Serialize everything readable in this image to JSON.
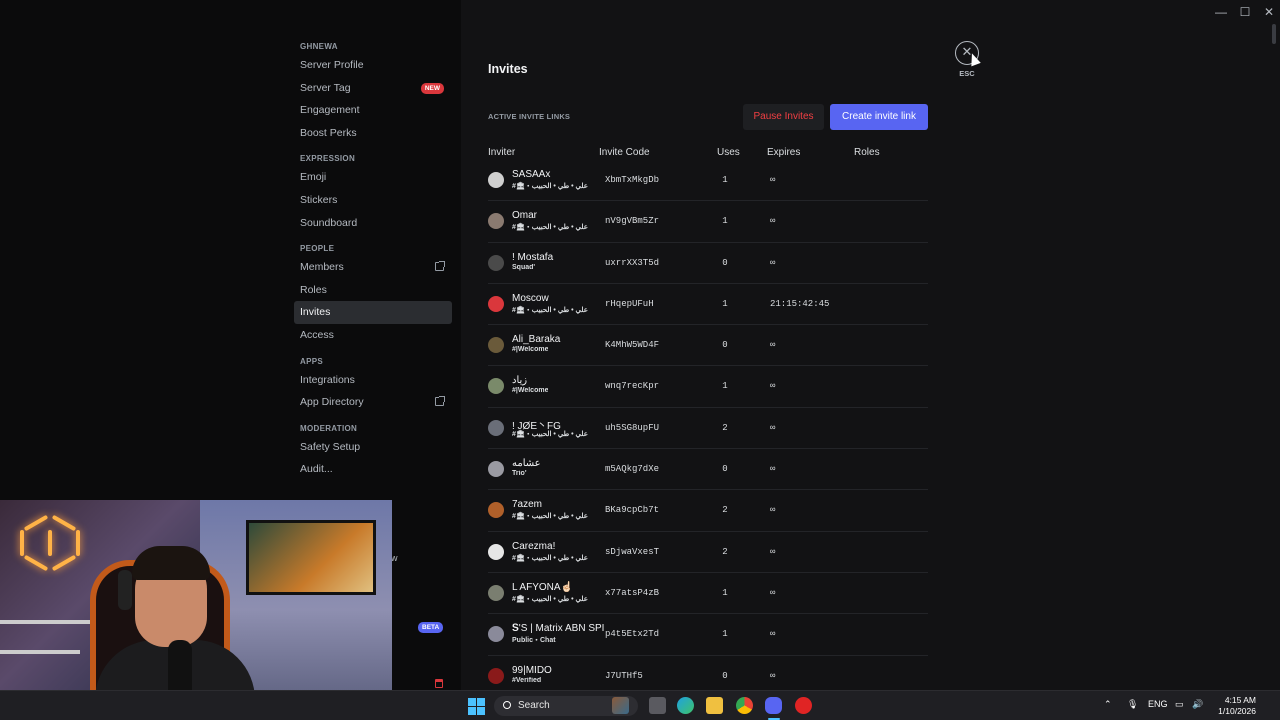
{
  "window": {
    "minimize": "—",
    "maximize": "☐",
    "close": "✕"
  },
  "sidebar": {
    "sections": [
      {
        "header": "GHNEWA",
        "items": [
          {
            "label": "Server Profile"
          },
          {
            "label": "Server Tag",
            "badge": "NEW"
          },
          {
            "label": "Engagement"
          },
          {
            "label": "Boost Perks"
          }
        ]
      },
      {
        "header": "EXPRESSION",
        "items": [
          {
            "label": "Emoji"
          },
          {
            "label": "Stickers"
          },
          {
            "label": "Soundboard"
          }
        ]
      },
      {
        "header": "PEOPLE",
        "items": [
          {
            "label": "Members"
          },
          {
            "label": "Roles"
          },
          {
            "label": "Invites"
          },
          {
            "label": "Access"
          }
        ]
      },
      {
        "header": "APPS",
        "items": [
          {
            "label": "Integrations"
          },
          {
            "label": "App Directory"
          }
        ]
      },
      {
        "header": "MODERATION",
        "items": [
          {
            "label": "Safety Setup"
          },
          {
            "label": "Audit..."
          }
        ]
      }
    ],
    "beta_badge": "BETA",
    "stray_text": "w"
  },
  "main": {
    "title": "Invites",
    "esc_label": "ESC",
    "close_glyph": "✕",
    "section_label": "ACTIVE INVITE LINKS",
    "pause_button": "Pause Invites",
    "create_button": "Create invite link",
    "columns": {
      "inviter": "Inviter",
      "code": "Invite Code",
      "uses": "Uses",
      "expires": "Expires",
      "roles": "Roles"
    },
    "rows": [
      {
        "name": "SASAAx",
        "channel": "#🏛・علي • طي • الحبيب",
        "code": "XbmTxMkgDb",
        "uses": "1",
        "expires": "∞",
        "avatar": "#cfcfcf"
      },
      {
        "name": "Omar",
        "channel": "#🏛・علي • طي • الحبيب",
        "code": "nV9gVBm5Zr",
        "uses": "1",
        "expires": "∞",
        "avatar": "#8a7a70"
      },
      {
        "name": "! Mostafa",
        "channel": "Squad'",
        "code": "uxrrXX3T5d",
        "uses": "0",
        "expires": "∞",
        "avatar": "#4a4a4a"
      },
      {
        "name": "Moscow",
        "channel": "#🏛・علي • طي • الحبيب",
        "code": "rHqepUFuH",
        "uses": "1",
        "expires": "21:15:42:45",
        "avatar": "#da373c"
      },
      {
        "name": "Ali_Baraka",
        "channel": "#|Welcome",
        "code": "K4MhW5WD4F",
        "uses": "0",
        "expires": "∞",
        "avatar": "#6a5a3a"
      },
      {
        "name": "زياد",
        "channel": "#|Welcome",
        "code": "wnq7recKpr",
        "uses": "1",
        "expires": "∞",
        "avatar": "#7a8a6a"
      },
      {
        "name": "! JØE丶FG",
        "channel": "#🏛・علي • طي • الحبيب",
        "code": "uh5SG8upFU",
        "uses": "2",
        "expires": "∞",
        "avatar": "#6a6e78"
      },
      {
        "name": "عشامه",
        "channel": "Trio'",
        "code": "m5AQkg7dXe",
        "uses": "0",
        "expires": "∞",
        "avatar": "#9a9aa2"
      },
      {
        "name": "7azem",
        "channel": "#🏛・علي • طي • الحبيب",
        "code": "BKa9cpCb7t",
        "uses": "2",
        "expires": "∞",
        "avatar": "#b0602a"
      },
      {
        "name": "Carezma!",
        "channel": "#🏛・علي • طي • الحبيب",
        "code": "sDjwaVxesT",
        "uses": "2",
        "expires": "∞",
        "avatar": "#e6e6e6"
      },
      {
        "name": "L AFYONA☝🏻",
        "channel": "#🏛・علي • طي • الحبيب",
        "code": "x77atsP4zB",
        "uses": "1",
        "expires": "∞",
        "avatar": "#7a7e70"
      },
      {
        "name": "𝐒'S | Matrix ABN SPI",
        "channel": "Public・Chat",
        "code": "p4t5Etx2Td",
        "uses": "1",
        "expires": "∞",
        "avatar": "#8a8a9a"
      },
      {
        "name": "99|MIDO",
        "channel": "#Verified",
        "code": "J7UTHf5",
        "uses": "0",
        "expires": "∞",
        "avatar": "#8a1a1a"
      }
    ]
  },
  "taskbar": {
    "search_placeholder": "Search",
    "tray_lang": "ENG",
    "time": "4:15 AM",
    "date": "1/10/2026",
    "icons": [
      "widgets-icon",
      "task-view-icon",
      "edge-icon",
      "file-explorer-icon",
      "chrome-icon",
      "discord-icon",
      "app-red-icon"
    ]
  },
  "colors": {
    "accent": "#5865f2",
    "danger": "#f23f43",
    "bg_main": "#121214",
    "bg_sidebar": "#0b0b0c"
  }
}
